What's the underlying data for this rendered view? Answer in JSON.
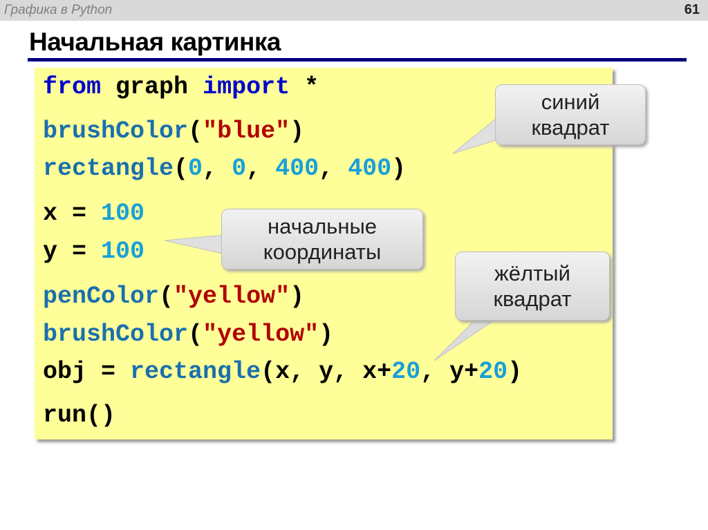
{
  "header": {
    "section": "Графика в Python",
    "page": "61"
  },
  "title": "Начальная картинка",
  "code": [
    [
      [
        "kw",
        "from "
      ],
      [
        "",
        "graph "
      ],
      [
        "kw",
        "import "
      ],
      [
        "",
        "*"
      ]
    ],
    [
      [
        "fn",
        "brushColor"
      ],
      [
        "",
        "("
      ],
      [
        "str",
        "\"blue\""
      ],
      [
        "",
        ")"
      ]
    ],
    [
      [
        "fn",
        "rectangle"
      ],
      [
        "",
        "("
      ],
      [
        "num",
        "0"
      ],
      [
        "",
        ", "
      ],
      [
        "num",
        "0"
      ],
      [
        "",
        ", "
      ],
      [
        "num",
        "400"
      ],
      [
        "",
        ", "
      ],
      [
        "num",
        "400"
      ],
      [
        "",
        ")"
      ]
    ],
    [
      [
        "",
        "x = "
      ],
      [
        "num",
        "100"
      ]
    ],
    [
      [
        "",
        "y = "
      ],
      [
        "num",
        "100"
      ]
    ],
    [
      [
        "fn",
        "penColor"
      ],
      [
        "",
        "("
      ],
      [
        "str",
        "\"yellow\""
      ],
      [
        "",
        ")"
      ]
    ],
    [
      [
        "fn",
        "brushColor"
      ],
      [
        "",
        "("
      ],
      [
        "str",
        "\"yellow\""
      ],
      [
        "",
        ")"
      ]
    ],
    [
      [
        "",
        "obj = "
      ],
      [
        "fn",
        "rectangle"
      ],
      [
        "",
        "(x, y, x+"
      ],
      [
        "num",
        "20"
      ],
      [
        "",
        ", y+"
      ],
      [
        "num",
        "20"
      ],
      [
        "",
        ")"
      ]
    ],
    [
      [
        "",
        "run()"
      ]
    ]
  ],
  "callouts": {
    "blue": "синий\nквадрат",
    "coords": "начальные\nкоординаты",
    "yellow": "жёлтый\nквадрат"
  },
  "colors": {
    "keyword": "#0000cc",
    "function": "#1a6fae",
    "number": "#1aa0d8",
    "string": "#b00000",
    "code_bg": "#ffff99",
    "rule": "#000080"
  }
}
